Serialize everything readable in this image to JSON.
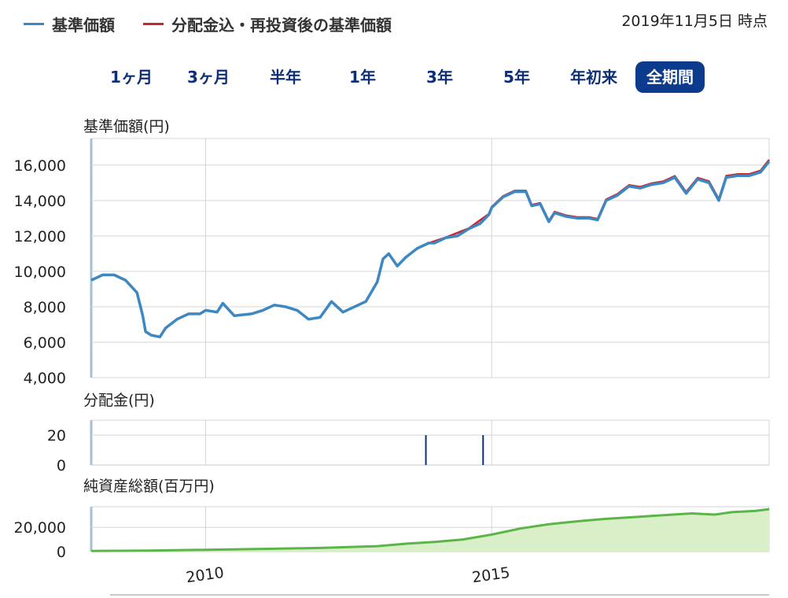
{
  "legend": {
    "items": [
      {
        "label": "基準価額",
        "color": "#3d87c2"
      },
      {
        "label": "分配金込・再投資後の基準価額",
        "color": "#c8282d"
      }
    ]
  },
  "as_of": "2019年11月5日 時点",
  "periods": [
    {
      "label": "1ヶ月",
      "active": false
    },
    {
      "label": "3ヶ月",
      "active": false
    },
    {
      "label": "半年",
      "active": false
    },
    {
      "label": "1年",
      "active": false
    },
    {
      "label": "3年",
      "active": false
    },
    {
      "label": "5年",
      "active": false
    },
    {
      "label": "年初来",
      "active": false
    },
    {
      "label": "全期間",
      "active": true
    }
  ],
  "colors": {
    "accent": "#0c3a8c",
    "nav": "#3d87c2",
    "reinvest": "#c8282d",
    "assets_line": "#5cb548",
    "assets_fill": "#d9efc8",
    "distribution": "#0c2f78"
  },
  "chart_data": [
    {
      "type": "line",
      "title": "基準価額(円)",
      "ylim": [
        4000,
        17500
      ],
      "yticks": [
        "4,000",
        "6,000",
        "8,000",
        "10,000",
        "12,000",
        "14,000",
        "16,000"
      ],
      "ytick_values": [
        4000,
        6000,
        8000,
        10000,
        12000,
        14000,
        16000
      ],
      "xticks": [
        "2010",
        "2015"
      ],
      "xtick_values": [
        2010,
        2015
      ],
      "xlim": [
        2008.0,
        2019.85
      ],
      "grid": true,
      "series": [
        {
          "name": "基準価額",
          "x": [
            2008.0,
            2008.2,
            2008.4,
            2008.6,
            2008.8,
            2008.9,
            2008.95,
            2009.05,
            2009.2,
            2009.3,
            2009.5,
            2009.7,
            2009.9,
            2010.0,
            2010.2,
            2010.3,
            2010.5,
            2010.8,
            2011.0,
            2011.2,
            2011.4,
            2011.6,
            2011.8,
            2012.0,
            2012.2,
            2012.4,
            2012.6,
            2012.8,
            2013.0,
            2013.1,
            2013.2,
            2013.35,
            2013.5,
            2013.7,
            2013.9,
            2014.0,
            2014.2,
            2014.4,
            2014.6,
            2014.8,
            2014.95,
            2015.0,
            2015.2,
            2015.4,
            2015.6,
            2015.7,
            2015.85,
            2016.0,
            2016.1,
            2016.3,
            2016.5,
            2016.7,
            2016.85,
            2017.0,
            2017.2,
            2017.4,
            2017.6,
            2017.8,
            2018.0,
            2018.2,
            2018.4,
            2018.6,
            2018.8,
            2018.97,
            2019.1,
            2019.3,
            2019.5,
            2019.7,
            2019.85
          ],
          "y": [
            9500,
            9800,
            9800,
            9500,
            8800,
            7500,
            6600,
            6400,
            6300,
            6800,
            7300,
            7600,
            7600,
            7800,
            7700,
            8200,
            7500,
            7600,
            7800,
            8100,
            8000,
            7800,
            7300,
            7400,
            8300,
            7700,
            8000,
            8300,
            9400,
            10700,
            11000,
            10300,
            10800,
            11300,
            11600,
            11600,
            11900,
            12000,
            12400,
            12700,
            13200,
            13600,
            14200,
            14500,
            14500,
            13700,
            13800,
            12800,
            13300,
            13100,
            13000,
            13000,
            12900,
            14000,
            14300,
            14800,
            14700,
            14900,
            15000,
            15300,
            14400,
            15200,
            15000,
            14000,
            15300,
            15400,
            15400,
            15600,
            16200
          ]
        },
        {
          "name": "分配金込・再投資後の基準価額",
          "x": [
            2013.9,
            2014.2,
            2014.6,
            2014.95,
            2015.0,
            2015.2,
            2015.4,
            2015.6,
            2015.7,
            2015.85,
            2016.0,
            2016.1,
            2016.3,
            2016.5,
            2016.7,
            2016.85,
            2017.0,
            2017.2,
            2017.4,
            2017.6,
            2017.8,
            2018.0,
            2018.2,
            2018.4,
            2018.6,
            2018.8,
            2018.97,
            2019.1,
            2019.3,
            2019.5,
            2019.7,
            2019.85
          ],
          "y": [
            11600,
            11920,
            12430,
            13240,
            13640,
            14250,
            14550,
            14550,
            13750,
            13860,
            12860,
            13360,
            13160,
            13060,
            13060,
            12960,
            14060,
            14370,
            14870,
            14770,
            14970,
            15080,
            15380,
            14480,
            15280,
            15080,
            14080,
            15390,
            15490,
            15490,
            15690,
            16300
          ]
        }
      ]
    },
    {
      "type": "bar",
      "title": "分配金(円)",
      "ylim": [
        0,
        30
      ],
      "yticks": [
        "0",
        "20"
      ],
      "ytick_values": [
        0,
        20
      ],
      "grid": true,
      "x": [
        2013.85,
        2014.85
      ],
      "values": [
        20,
        20
      ]
    },
    {
      "type": "area",
      "title": "純資産総額(百万円)",
      "ylim": [
        0,
        37000
      ],
      "yticks": [
        "0",
        "20,000"
      ],
      "ytick_values": [
        0,
        20000
      ],
      "grid": true,
      "x": [
        2008.0,
        2009.0,
        2010.0,
        2011.0,
        2012.0,
        2013.0,
        2013.5,
        2014.0,
        2014.5,
        2015.0,
        2015.5,
        2016.0,
        2016.5,
        2017.0,
        2017.5,
        2018.0,
        2018.5,
        2018.9,
        2019.2,
        2019.6,
        2019.85
      ],
      "values": [
        500,
        800,
        1500,
        2200,
        3000,
        4500,
        6500,
        8000,
        10000,
        14000,
        19000,
        22500,
        25000,
        27000,
        28500,
        30000,
        31500,
        30500,
        32500,
        33500,
        35000
      ]
    }
  ]
}
